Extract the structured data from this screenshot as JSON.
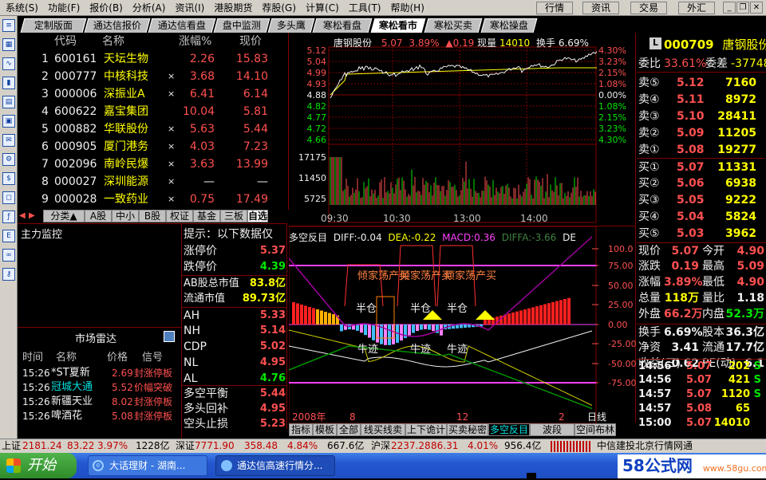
{
  "menu": [
    "系统(S)",
    "功能(F)",
    "报价(B)",
    "分析(A)",
    "资讯(I)",
    "港股期货",
    "荐股(G)",
    "计算(C)",
    "工具(T)",
    "帮助(H)"
  ],
  "topbuttons": [
    "行情",
    "资讯",
    "交易",
    "外汇"
  ],
  "tabs": [
    "定制版面",
    "通达信报价",
    "通达信看盘",
    "盘中监测",
    "多头鹰",
    "寒松看盘",
    "寒松看市",
    "寒松买卖",
    "寒松操盘"
  ],
  "active_tab": "寒松看市",
  "quote_table": {
    "headers": [
      "代码",
      "名称",
      "涨幅%",
      "现价"
    ],
    "rows": [
      {
        "no": "1",
        "code": "600161",
        "name": "天坛生物",
        "mark": "",
        "pct": "2.26",
        "price": "15.83",
        "color": "red"
      },
      {
        "no": "2",
        "code": "000777",
        "name": "中核科技",
        "mark": "×",
        "pct": "3.68",
        "price": "14.10",
        "color": "red"
      },
      {
        "no": "3",
        "code": "000006",
        "name": "深振业A",
        "mark": "×",
        "pct": "6.41",
        "price": "6.14",
        "color": "red"
      },
      {
        "no": "4",
        "code": "600622",
        "name": "嘉宝集团",
        "mark": "",
        "pct": "10.04",
        "price": "5.81",
        "color": "red"
      },
      {
        "no": "5",
        "code": "000882",
        "name": "华联股份",
        "mark": "×",
        "pct": "5.63",
        "price": "5.44",
        "color": "red"
      },
      {
        "no": "6",
        "code": "000905",
        "name": "厦门港务",
        "mark": "×",
        "pct": "4.03",
        "price": "7.23",
        "color": "red"
      },
      {
        "no": "7",
        "code": "002096",
        "name": "南岭民爆",
        "mark": "×",
        "pct": "3.63",
        "price": "13.99",
        "color": "red"
      },
      {
        "no": "8",
        "code": "000027",
        "name": "深圳能源",
        "mark": "×",
        "pct": "—",
        "price": "—",
        "color": "white"
      },
      {
        "no": "9",
        "code": "000028",
        "name": "一致药业",
        "mark": "×",
        "pct": "0.75",
        "price": "17.49",
        "color": "red"
      }
    ],
    "categories": [
      "分类▲",
      "A股",
      "中小",
      "B股",
      "权证",
      "基金",
      "三板",
      "自选"
    ]
  },
  "monitor": {
    "title": "主力监控"
  },
  "radar": {
    "title": "市场雷达",
    "headers": [
      "时间",
      "名称",
      "价格",
      "信号"
    ],
    "rows": [
      {
        "time": "15:26",
        "name": "*ST夏新",
        "price": "2.69",
        "signal": "封涨停板",
        "color": "white"
      },
      {
        "time": "15:26",
        "name": "冠城大通",
        "price": "5.52",
        "signal": "价幅突破",
        "color": "cyan"
      },
      {
        "time": "15:26",
        "name": "新疆天业",
        "price": "8.02",
        "signal": "封涨停板",
        "color": "white"
      },
      {
        "time": "15:26",
        "name": "啤酒花",
        "price": "5.08",
        "signal": "封涨停板",
        "color": "white"
      }
    ]
  },
  "hint": {
    "title": "提示：以下数据仅",
    "items": [
      {
        "label": "涨停价",
        "value": "5.37",
        "color": "red"
      },
      {
        "label": "跌停价",
        "value": "4.39",
        "color": "green"
      },
      {
        "label": "AB股总市值",
        "value": "83.8亿",
        "color": "yellow"
      },
      {
        "label": "流通市值",
        "value": "89.73亿",
        "color": "yellow"
      },
      {
        "label": "AH",
        "value": "5.33",
        "color": "red"
      },
      {
        "label": "NH",
        "value": "5.14",
        "color": "red"
      },
      {
        "label": "CDP",
        "value": "5.02",
        "color": "red"
      },
      {
        "label": "NL",
        "value": "4.95",
        "color": "red"
      },
      {
        "label": "AL",
        "value": "4.76",
        "color": "green"
      },
      {
        "label": "多空平衡",
        "value": "5.44",
        "color": "red"
      },
      {
        "label": "多头回补",
        "value": "4.95",
        "color": "red"
      },
      {
        "label": "空头止损",
        "value": "5.23",
        "color": "red"
      }
    ]
  },
  "intraday": {
    "title": "唐钢股份",
    "price": "5.07",
    "pct": "3.89%",
    "change": "▲0.19",
    "volume_label": "现量",
    "volume": "14010",
    "turnover_label": "换手",
    "turnover": "6.69%",
    "left_ticks": [
      "5.12",
      "5.04",
      "4.99",
      "4.93",
      "4.88",
      "4.82",
      "4.77",
      "4.72",
      "4.66"
    ],
    "right_ticks": [
      "4.30%",
      "3.23%",
      "2.15%",
      "1.08%",
      "0.00%",
      "1.08%",
      "2.15%",
      "3.23%",
      "4.30%"
    ],
    "vol_ticks": [
      "17175",
      "11450",
      "5725"
    ],
    "time_ticks": [
      "09:30",
      "10:30",
      "13:00",
      "14:00"
    ]
  },
  "indicator": {
    "name": "多空反目",
    "diff": "DIFF:-0.04",
    "dea": "DEA:-0.22",
    "macd": "MACD:0.36",
    "diffa": "DIFFA:-3.66",
    "de": "DE",
    "right_ticks": [
      "100.0",
      "75.00",
      "50.00",
      "25.00",
      "0.00",
      "-25.00",
      "-50.00",
      "-75.00"
    ],
    "text_top": "倾家荡产买",
    "half_warehouse": "半仓",
    "bull_trail": "牛迹",
    "date_labels": [
      "2008年",
      "8",
      "12",
      "2",
      "日线"
    ]
  },
  "indicator_tabs": [
    "指标",
    "模板",
    "全部",
    "线买线卖",
    "上下诡计",
    "买卖秘密",
    "多空反目",
    "波段MACD",
    "空间布林"
  ],
  "stock": {
    "code": "000709",
    "name": "唐钢股份",
    "weibi_label": "委比",
    "weibi": "33.61%",
    "weicha_label": "委差",
    "weicha": "-37748",
    "sells": [
      {
        "label": "卖⑤",
        "price": "5.12",
        "vol": "7160"
      },
      {
        "label": "卖④",
        "price": "5.11",
        "vol": "8972"
      },
      {
        "label": "卖③",
        "price": "5.10",
        "vol": "28411"
      },
      {
        "label": "卖②",
        "price": "5.09",
        "vol": "11205"
      },
      {
        "label": "卖①",
        "price": "5.08",
        "vol": "19277"
      }
    ],
    "buys": [
      {
        "label": "买①",
        "price": "5.07",
        "vol": "11331"
      },
      {
        "label": "买②",
        "price": "5.06",
        "vol": "6938"
      },
      {
        "label": "买③",
        "price": "5.05",
        "vol": "9222"
      },
      {
        "label": "买④",
        "price": "5.04",
        "vol": "5824"
      },
      {
        "label": "买⑤",
        "price": "5.03",
        "vol": "3962"
      }
    ],
    "stats": [
      {
        "l1": "现价",
        "v1": "5.07",
        "c1": "red",
        "l2": "今开",
        "v2": "4.90",
        "c2": "red"
      },
      {
        "l1": "涨跌",
        "v1": "0.19",
        "c1": "red",
        "l2": "最高",
        "v2": "5.09",
        "c2": "red"
      },
      {
        "l1": "涨幅",
        "v1": "3.89%",
        "c1": "red",
        "l2": "最低",
        "v2": "4.90",
        "c2": "red"
      },
      {
        "l1": "总量",
        "v1": "118万",
        "c1": "yellow",
        "l2": "量比",
        "v2": "1.18",
        "c2": "white"
      },
      {
        "l1": "外盘",
        "v1": "66.2万",
        "c1": "red",
        "l2": "内盘",
        "v2": "52.3万",
        "c2": "green"
      },
      {
        "l1": "换手",
        "v1": "6.69%",
        "c1": "white",
        "l2": "股本",
        "v2": "36.3亿",
        "c2": "white"
      },
      {
        "l1": "净资",
        "v1": "3.41",
        "c1": "white",
        "l2": "流通",
        "v2": "17.7亿",
        "c2": "white"
      },
      {
        "l1": "收益(三)",
        "v1": "0.62",
        "c1": "white",
        "l2": "PE(动)",
        "v2": "6.1",
        "c2": "white"
      }
    ],
    "ticks": [
      {
        "t": "14:56",
        "p": "5.07",
        "v": "202",
        "d": "S",
        "dc": "green"
      },
      {
        "t": "14:56",
        "p": "5.07",
        "v": "421",
        "d": "S",
        "dc": "green"
      },
      {
        "t": "14:57",
        "p": "5.07",
        "v": "1120",
        "d": "S",
        "dc": "green"
      },
      {
        "t": "14:57",
        "p": "5.08",
        "v": "65",
        "d": "",
        "dc": "white"
      },
      {
        "t": "15:00",
        "p": "5.07",
        "v": "14010",
        "d": "",
        "dc": "white"
      }
    ]
  },
  "statusbar": {
    "sh_label": "上证",
    "sh": "2181.24",
    "sh_chg": "83.22",
    "sh_pct": "3.97%",
    "sh_amt": "1228亿",
    "sz_label": "深证",
    "sz": "7771.90",
    "sz_chg": "358.48",
    "sz_pct": "4.84%",
    "sz_amt": "667.6亿",
    "hs_label": "沪深",
    "hs": "2237.28",
    "hs_chg": "86.31",
    "hs_pct": "4.01%",
    "hs_amt": "956.4亿",
    "broker": "中信建投北京行情网通"
  },
  "taskbar": {
    "start": "开始",
    "tasks": [
      "大话理财 - 湖南...",
      "通达信高速行情分..."
    ],
    "watermark": "58公式网",
    "url": "www.58gu.com"
  }
}
